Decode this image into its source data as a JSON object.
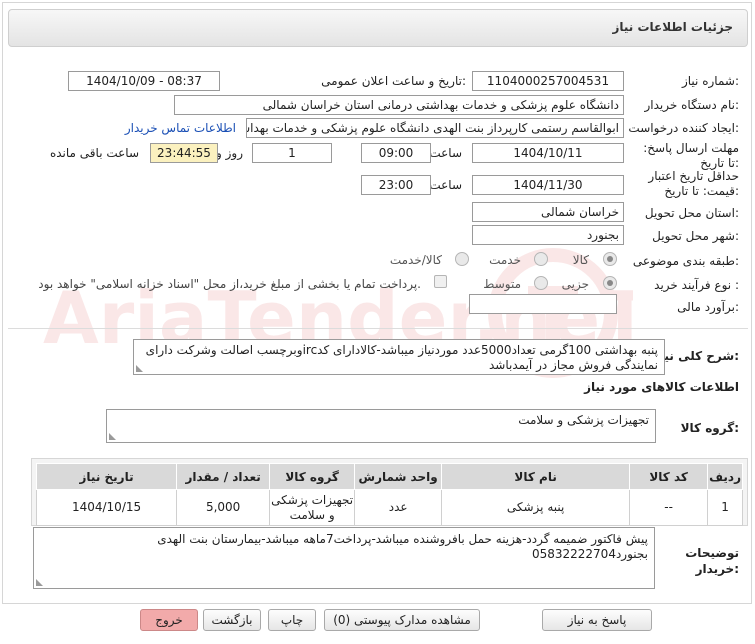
{
  "header": {
    "title": "جزئیات اطلاعات نیاز"
  },
  "watermark_text": "AriaTender.neT",
  "fields": {
    "need_number_label": "شماره نیاز:",
    "need_number": "1104000257004531",
    "announce_label": "تاریخ و ساعت اعلان عمومی:",
    "announce_value": "1404/10/09 - 08:37",
    "buyer_org_label": "نام دستگاه خریدار:",
    "buyer_org": "دانشگاه علوم پزشکی و خدمات بهداشتی درمانی استان خراسان شمالی",
    "requester_label": "ایجاد کننده درخواست:",
    "requester": "ابوالقاسم رستمی کارپرداز بنت الهدی دانشگاه علوم پزشکی و خدمات بهداشتی",
    "contact_link": "اطلاعات تماس خریدار",
    "reply_deadline_label": "مهلت ارسال پاسخ: تا تاریخ:",
    "reply_date": "1404/10/11",
    "time_label": "ساعت",
    "reply_time": "09:00",
    "day_label": "روز و",
    "days": "1",
    "remaining_time": "23:44:55",
    "remaining_label": "ساعت باقی مانده",
    "price_validity_label": "حداقل تاریخ اعتبار قیمت: تا تاریخ:",
    "validity_date": "1404/11/30",
    "validity_time": "23:00",
    "province_label": "استان محل تحویل:",
    "province": "خراسان شمالی",
    "city_label": "شهر محل تحویل:",
    "city": "بجنورد",
    "category_label": "طبقه بندی موضوعی:",
    "category_options": [
      "کالا",
      "خدمت",
      "کالا/خدمت"
    ],
    "process_label": "نوع فرآیند خرید :",
    "process_options": [
      "جزیی",
      "متوسط"
    ],
    "payment_note": "پرداخت تمام یا بخشی از مبلغ خرید،از محل \"اسناد خزانه اسلامی\" خواهد بود.",
    "budget_label": "برآورد مالی:",
    "budget_value": ""
  },
  "summary": {
    "label": "شرح کلی نیاز:",
    "text": "پنبه بهداشتی 100گرمی تعداد5000عدد موردنیاز میباشد-کالادارای کدircوبرچسب اصالت وشرکت دارای نمایندگی فروش مجاز در آیمدباشد"
  },
  "goods_section": {
    "title": "اطلاعات کالاهای مورد نیاز",
    "group_label": "گروه کالا:",
    "group_value": "تجهیزات پزشکی و سلامت"
  },
  "table": {
    "headers": [
      "ردیف",
      "کد کالا",
      "نام کالا",
      "واحد شمارش",
      "گروه کالا",
      "تعداد / مقدار",
      "تاریخ نیاز"
    ],
    "rows": [
      {
        "row": "1",
        "code": "--",
        "name": "پنبه پزشکی",
        "unit": "عدد",
        "group": "تجهیزات پزشکی و سلامت",
        "qty": "5,000",
        "date": "1404/10/15"
      }
    ]
  },
  "buyer_notes": {
    "label": "توضیحات خریدار:",
    "text": "پیش فاکتور ضمیمه گردد-هزینه حمل بافروشنده میباشد-پرداخت7ماهه میباشد-بیمارستان بنت الهدی بجنورد05832222704"
  },
  "buttons": {
    "reply": "پاسخ به نیاز",
    "view_docs": "مشاهده مدارک پیوستی (0)",
    "print": "چاپ",
    "back": "بازگشت",
    "exit": "خروج"
  }
}
